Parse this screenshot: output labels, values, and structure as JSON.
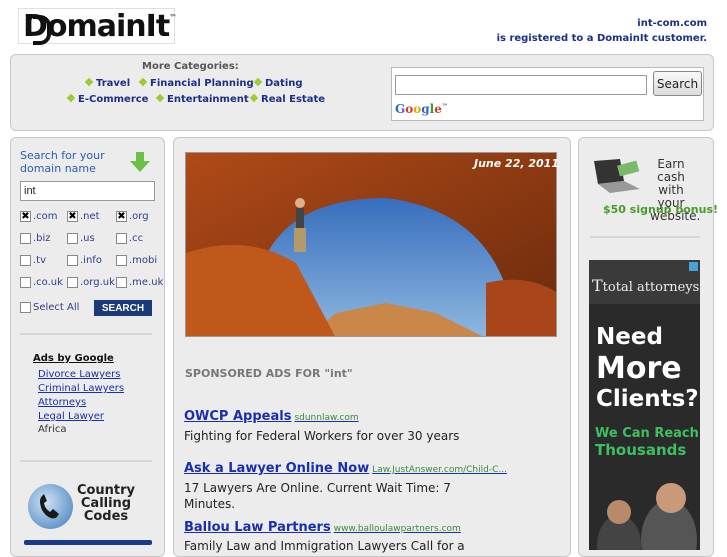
{
  "header": {
    "logo_text": "DomainIt",
    "logo_tm": "™",
    "registered_line1": "int-com.com",
    "registered_line2": "is registered to a DomainIt customer."
  },
  "categories": {
    "heading": "More Categories:",
    "items": [
      "Travel",
      "Financial Planning",
      "Dating",
      "E-Commerce",
      "Entertainment",
      "Real Estate"
    ]
  },
  "google_search": {
    "button_label": "Search",
    "input_value": "",
    "logo_text": "Google",
    "logo_tm": "™"
  },
  "domain_search": {
    "heading_line1": "Search for your",
    "heading_line2": "domain name",
    "input_value": "int",
    "tlds": [
      {
        "label": ".com",
        "checked": true
      },
      {
        "label": ".net",
        "checked": true
      },
      {
        "label": ".org",
        "checked": true
      },
      {
        "label": ".biz",
        "checked": false
      },
      {
        "label": ".us",
        "checked": false
      },
      {
        "label": ".cc",
        "checked": false
      },
      {
        "label": ".tv",
        "checked": false
      },
      {
        "label": ".info",
        "checked": false
      },
      {
        "label": ".mobi",
        "checked": false
      },
      {
        "label": ".co.uk",
        "checked": false
      },
      {
        "label": ".org.uk",
        "checked": false
      },
      {
        "label": ".me.uk",
        "checked": false
      }
    ],
    "select_all_label": "Select All",
    "search_button": "SEARCH"
  },
  "ads_by_google": {
    "heading": "Ads by Google",
    "links": [
      "Divorce Lawyers",
      "Criminal Lawyers",
      "Attorneys",
      "Legal Lawyer"
    ],
    "extra_text": "Africa"
  },
  "country_codes": {
    "text": "Country Calling Codes"
  },
  "main": {
    "photo_date": "June 22, 2011",
    "sponsored_heading": "SPONSORED ADS FOR \"int\"",
    "ads": [
      {
        "title": "OWCP Appeals",
        "url": "sdunnlaw.com",
        "desc": "Fighting for Federal Workers for over 30 years"
      },
      {
        "title": "Ask a Lawyer Online Now",
        "url": "Law.JustAnswer.com/Child-C...",
        "desc": "17 Lawyers Are Online. Current Wait Time: 7 Minutes."
      },
      {
        "title": "Ballou Law Partners",
        "url": "www.balloulawpartners.com",
        "desc": "Family Law and Immigration Lawyers Call for a"
      }
    ]
  },
  "right": {
    "earn_text": "Earn cash with your website.",
    "bonus_text": "$50 signup bonus!",
    "banner_brand": "total attorneys",
    "banner_line1": "Need",
    "banner_line2": "More",
    "banner_line3": "Clients?",
    "banner_reach1": "We Can Reach",
    "banner_reach2": "Thousands"
  },
  "colors": {
    "link_blue": "#1a2fb0",
    "nav_blue": "#1a2f8a",
    "panel_gray": "#ececec",
    "accent_green": "#9acd32",
    "button_navy": "#1b3a7a"
  }
}
